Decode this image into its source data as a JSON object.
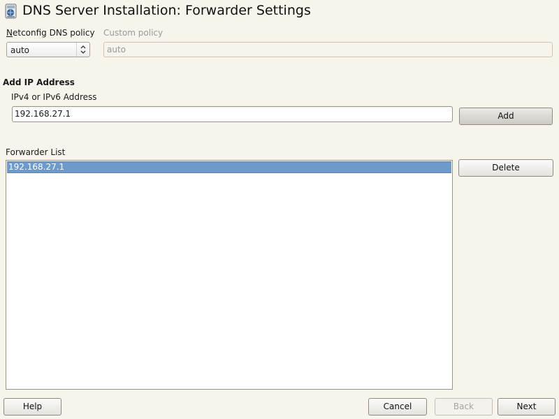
{
  "window": {
    "title": "DNS Server Installation: Forwarder Settings",
    "icon": "dns-server-icon"
  },
  "netconfig": {
    "label": "Netconfig DNS policy",
    "value": "auto",
    "custom_label": "Custom policy",
    "custom_value": "auto"
  },
  "add_ip": {
    "heading": "Add IP Address",
    "field_label": "IPv4 or IPv6 Address",
    "field_value": "192.168.27.1",
    "add_button": "Add"
  },
  "forwarder_list": {
    "label": "Forwarder List",
    "items": [
      "192.168.27.1"
    ],
    "selected_index": 0,
    "delete_button": "Delete"
  },
  "footer": {
    "help": "Help",
    "cancel": "Cancel",
    "back": "Back",
    "next": "Next"
  },
  "colors": {
    "background": "#f7f4ec",
    "selection": "#6e9acb"
  }
}
